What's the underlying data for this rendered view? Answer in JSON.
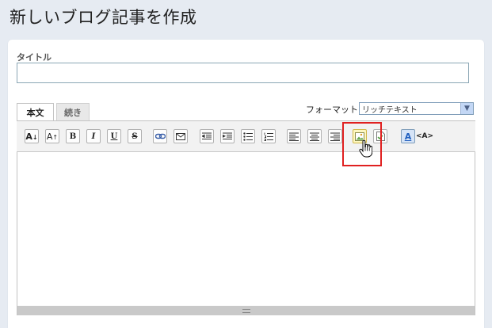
{
  "page": {
    "title": "新しいブログ記事を作成"
  },
  "title_field": {
    "label": "タイトル",
    "value": ""
  },
  "tabs": [
    {
      "label": "本文",
      "active": true
    },
    {
      "label": "続き",
      "active": false
    }
  ],
  "format": {
    "label": "フォーマット:",
    "selected": "リッチテキスト"
  },
  "toolbar": {
    "font_smaller": "A",
    "font_larger": "A",
    "bold": "B",
    "italic": "I",
    "underline": "U",
    "strike": "S",
    "text_color": "A",
    "source": "<A>"
  },
  "colors": {
    "highlight": "#e02020",
    "accent": "#1f5fbf",
    "page_bg": "#e6ebf2"
  }
}
